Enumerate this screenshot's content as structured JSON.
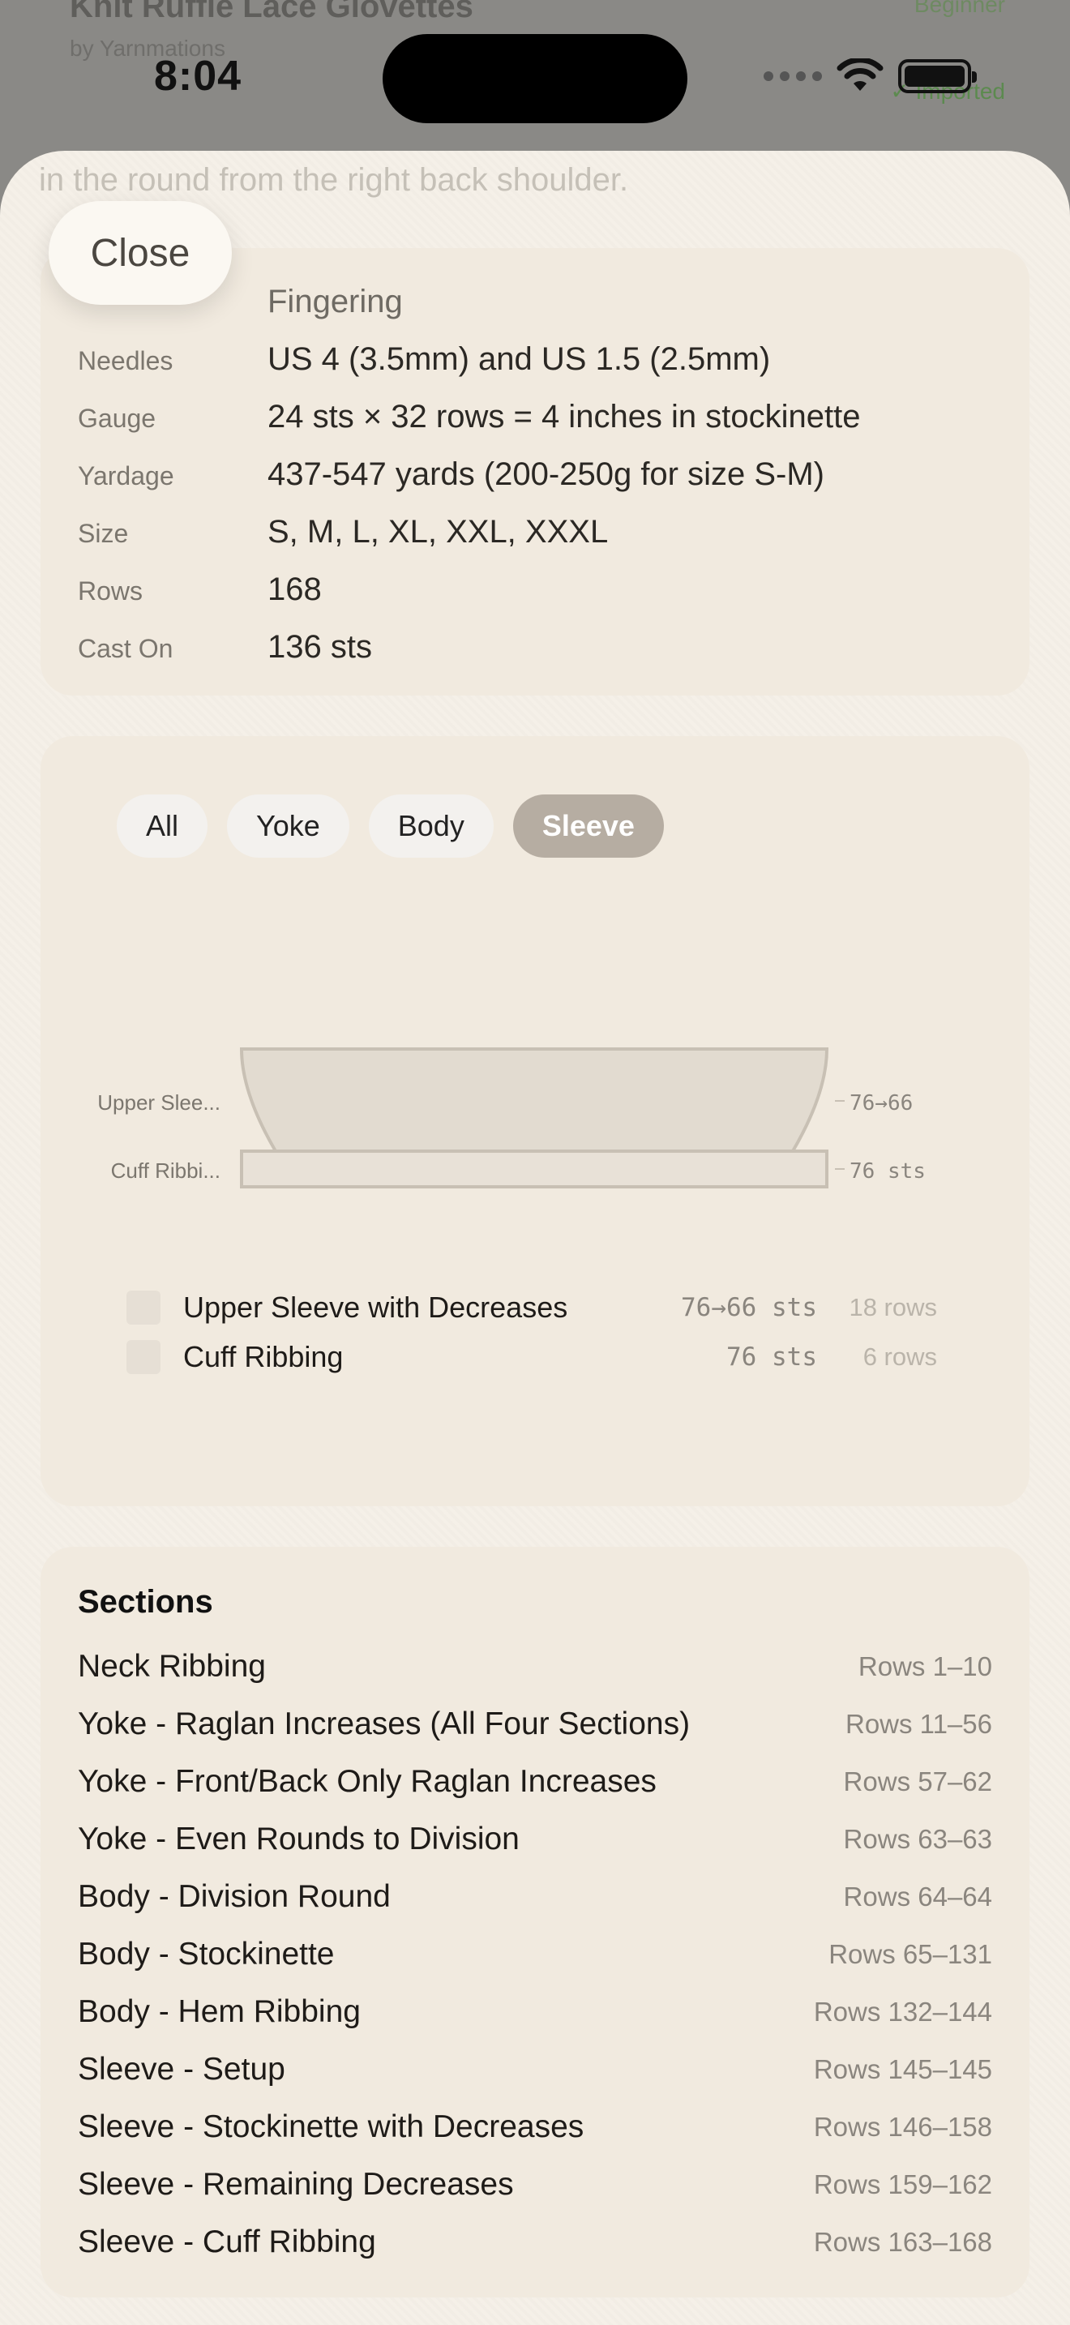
{
  "background": {
    "title": "Knit Ruffle Lace Glovettes",
    "author": "by Yarnmations",
    "badge_top": "Beginner",
    "badge_bottom": "✓ Imported"
  },
  "status_bar": {
    "time": "8:04"
  },
  "sheet": {
    "faded_text": "in the round from the right back shoulder.",
    "close_label": "Close"
  },
  "details": {
    "weight_value": "Fingering",
    "rows": [
      {
        "label": "Needles",
        "value": "US 4 (3.5mm) and US 1.5 (2.5mm)"
      },
      {
        "label": "Gauge",
        "value": "24 sts × 32 rows = 4 inches in stockinette"
      },
      {
        "label": "Yardage",
        "value": "437-547 yards (200-250g for size S-M)"
      },
      {
        "label": "Size",
        "value": "S, M, L, XL, XXL, XXXL"
      },
      {
        "label": "Rows",
        "value": "168"
      },
      {
        "label": "Cast On",
        "value": "136 sts"
      }
    ]
  },
  "schematic": {
    "filters": [
      "All",
      "Yoke",
      "Body",
      "Sleeve"
    ],
    "active_filter": "Sleeve",
    "diagram_labels": {
      "upper_left": "Upper Slee...",
      "upper_right": "76→66",
      "cuff_left": "Cuff Ribbi...",
      "cuff_right": "76 sts"
    },
    "legend": [
      {
        "name": "Upper Sleeve with Decreases",
        "sts": "76→66 sts",
        "rows": "18 rows"
      },
      {
        "name": "Cuff Ribbing",
        "sts": "76 sts",
        "rows": "6 rows"
      }
    ],
    "colors": {
      "shape_fill": "#e2dbd0",
      "shape_stroke": "#c8c0b4",
      "chip_active": "#b6ada2"
    }
  },
  "sections": {
    "title": "Sections",
    "items": [
      {
        "name": "Neck Ribbing",
        "rows": "Rows 1–10"
      },
      {
        "name": "Yoke - Raglan Increases (All Four Sections)",
        "rows": "Rows 11–56"
      },
      {
        "name": "Yoke - Front/Back Only Raglan Increases",
        "rows": "Rows 57–62"
      },
      {
        "name": "Yoke - Even Rounds to Division",
        "rows": "Rows 63–63"
      },
      {
        "name": "Body - Division Round",
        "rows": "Rows 64–64"
      },
      {
        "name": "Body - Stockinette",
        "rows": "Rows 65–131"
      },
      {
        "name": "Body - Hem Ribbing",
        "rows": "Rows 132–144"
      },
      {
        "name": "Sleeve - Setup",
        "rows": "Rows 145–145"
      },
      {
        "name": "Sleeve - Stockinette with Decreases",
        "rows": "Rows 146–158"
      },
      {
        "name": "Sleeve - Remaining Decreases",
        "rows": "Rows 159–162"
      },
      {
        "name": "Sleeve - Cuff Ribbing",
        "rows": "Rows 163–168"
      }
    ]
  }
}
